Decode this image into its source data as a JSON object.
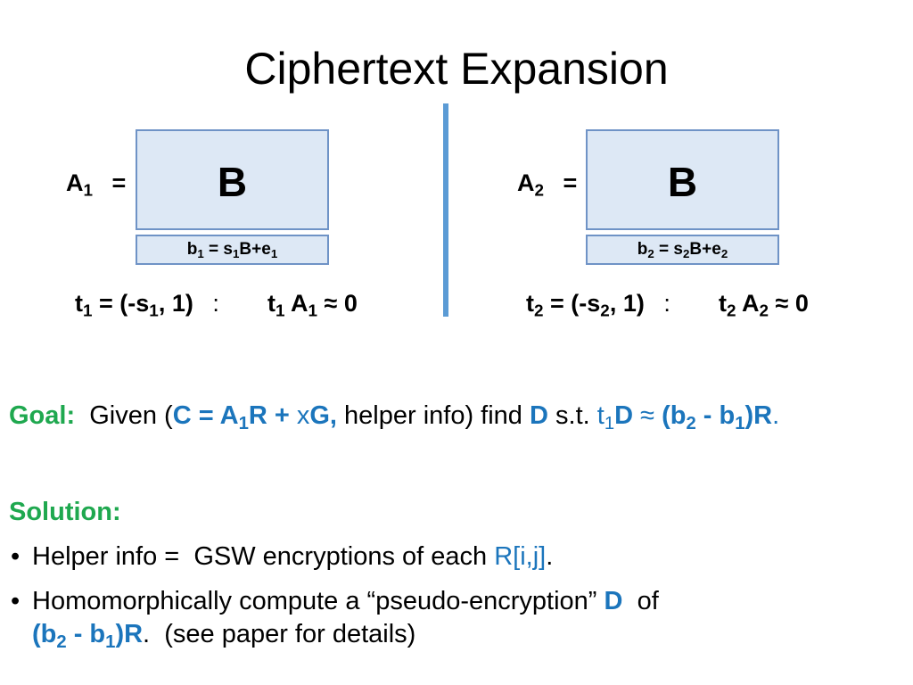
{
  "title": "Ciphertext Expansion",
  "left": {
    "lhs": "A",
    "lhs_sub": "1",
    "eq": "=",
    "matrix_label": "B",
    "row": {
      "b": "b",
      "b_sub": "1",
      "mid": " = s",
      "s_sub": "1",
      "rest": "B+e",
      "e_sub": "1"
    },
    "trap": {
      "t": "t",
      "t_sub": "1",
      "eq": " = (-s",
      "s_sub": "1",
      "close": ", 1)",
      "colon": ":",
      "t2": "t",
      "t2_sub": "1",
      "A": " A",
      "A_sub": "1",
      "approx": " ≈ 0"
    }
  },
  "right": {
    "lhs": "A",
    "lhs_sub": "2",
    "eq": "=",
    "matrix_label": "B",
    "row": {
      "b": "b",
      "b_sub": "2",
      "mid": " = s",
      "s_sub": "2",
      "rest": "B+e",
      "e_sub": "2"
    },
    "trap": {
      "t": "t",
      "t_sub": "2",
      "eq": " = (-s",
      "s_sub": "2",
      "close": ", 1)",
      "colon": ":",
      "t2": "t",
      "t2_sub": "2",
      "A": " A",
      "A_sub": "2",
      "approx": " ≈ 0"
    }
  },
  "goal": {
    "label": "Goal:",
    "given": "  Given (",
    "c_expr": "C = A",
    "c_sub": "1",
    "c_rest": "R + ",
    "x": "x",
    "G": "G,",
    "helper": " helper info) find ",
    "D": "D",
    "st": " s.t. ",
    "t": "t",
    "t_sub": "1",
    "tD": "D",
    "approx": " ≈ ",
    "b2": "(b",
    "b2_sub": "2",
    "minus": " - b",
    "b1_sub": "1",
    "end": ")R",
    "period": "."
  },
  "solution": {
    "label": "Solution:",
    "bullets": [
      {
        "text": "Helper info =  GSW encryptions of each ",
        "highlight": "R[i,j]",
        "end": "."
      },
      {
        "text": "Homomorphically compute a “pseudo-encryption” ",
        "highlight": "D",
        "end": "  of"
      }
    ],
    "cont": {
      "b2": "(b",
      "b2_sub": "2",
      "minus": " - b",
      "b1_sub": "1",
      "end": ")R",
      "period": ".",
      "rest": "  (see paper for details)"
    }
  },
  "colors": {
    "accent_blue": "#1b75bc",
    "accent_green": "#1fa84f",
    "box_fill": "#dde8f5",
    "box_border": "#6f93c6",
    "divider": "#5b9bd5"
  }
}
